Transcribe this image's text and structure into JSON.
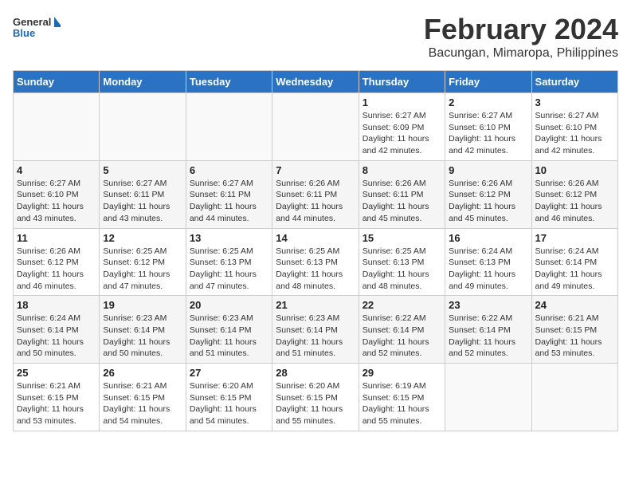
{
  "logo": {
    "general": "General",
    "blue": "Blue"
  },
  "title": "February 2024",
  "subtitle": "Bacungan, Mimaropa, Philippines",
  "days_of_week": [
    "Sunday",
    "Monday",
    "Tuesday",
    "Wednesday",
    "Thursday",
    "Friday",
    "Saturday"
  ],
  "weeks": [
    [
      {
        "day": "",
        "info": ""
      },
      {
        "day": "",
        "info": ""
      },
      {
        "day": "",
        "info": ""
      },
      {
        "day": "",
        "info": ""
      },
      {
        "day": "1",
        "info": "Sunrise: 6:27 AM\nSunset: 6:09 PM\nDaylight: 11 hours and 42 minutes."
      },
      {
        "day": "2",
        "info": "Sunrise: 6:27 AM\nSunset: 6:10 PM\nDaylight: 11 hours and 42 minutes."
      },
      {
        "day": "3",
        "info": "Sunrise: 6:27 AM\nSunset: 6:10 PM\nDaylight: 11 hours and 42 minutes."
      }
    ],
    [
      {
        "day": "4",
        "info": "Sunrise: 6:27 AM\nSunset: 6:10 PM\nDaylight: 11 hours and 43 minutes."
      },
      {
        "day": "5",
        "info": "Sunrise: 6:27 AM\nSunset: 6:11 PM\nDaylight: 11 hours and 43 minutes."
      },
      {
        "day": "6",
        "info": "Sunrise: 6:27 AM\nSunset: 6:11 PM\nDaylight: 11 hours and 44 minutes."
      },
      {
        "day": "7",
        "info": "Sunrise: 6:26 AM\nSunset: 6:11 PM\nDaylight: 11 hours and 44 minutes."
      },
      {
        "day": "8",
        "info": "Sunrise: 6:26 AM\nSunset: 6:11 PM\nDaylight: 11 hours and 45 minutes."
      },
      {
        "day": "9",
        "info": "Sunrise: 6:26 AM\nSunset: 6:12 PM\nDaylight: 11 hours and 45 minutes."
      },
      {
        "day": "10",
        "info": "Sunrise: 6:26 AM\nSunset: 6:12 PM\nDaylight: 11 hours and 46 minutes."
      }
    ],
    [
      {
        "day": "11",
        "info": "Sunrise: 6:26 AM\nSunset: 6:12 PM\nDaylight: 11 hours and 46 minutes."
      },
      {
        "day": "12",
        "info": "Sunrise: 6:25 AM\nSunset: 6:12 PM\nDaylight: 11 hours and 47 minutes."
      },
      {
        "day": "13",
        "info": "Sunrise: 6:25 AM\nSunset: 6:13 PM\nDaylight: 11 hours and 47 minutes."
      },
      {
        "day": "14",
        "info": "Sunrise: 6:25 AM\nSunset: 6:13 PM\nDaylight: 11 hours and 48 minutes."
      },
      {
        "day": "15",
        "info": "Sunrise: 6:25 AM\nSunset: 6:13 PM\nDaylight: 11 hours and 48 minutes."
      },
      {
        "day": "16",
        "info": "Sunrise: 6:24 AM\nSunset: 6:13 PM\nDaylight: 11 hours and 49 minutes."
      },
      {
        "day": "17",
        "info": "Sunrise: 6:24 AM\nSunset: 6:14 PM\nDaylight: 11 hours and 49 minutes."
      }
    ],
    [
      {
        "day": "18",
        "info": "Sunrise: 6:24 AM\nSunset: 6:14 PM\nDaylight: 11 hours and 50 minutes."
      },
      {
        "day": "19",
        "info": "Sunrise: 6:23 AM\nSunset: 6:14 PM\nDaylight: 11 hours and 50 minutes."
      },
      {
        "day": "20",
        "info": "Sunrise: 6:23 AM\nSunset: 6:14 PM\nDaylight: 11 hours and 51 minutes."
      },
      {
        "day": "21",
        "info": "Sunrise: 6:23 AM\nSunset: 6:14 PM\nDaylight: 11 hours and 51 minutes."
      },
      {
        "day": "22",
        "info": "Sunrise: 6:22 AM\nSunset: 6:14 PM\nDaylight: 11 hours and 52 minutes."
      },
      {
        "day": "23",
        "info": "Sunrise: 6:22 AM\nSunset: 6:14 PM\nDaylight: 11 hours and 52 minutes."
      },
      {
        "day": "24",
        "info": "Sunrise: 6:21 AM\nSunset: 6:15 PM\nDaylight: 11 hours and 53 minutes."
      }
    ],
    [
      {
        "day": "25",
        "info": "Sunrise: 6:21 AM\nSunset: 6:15 PM\nDaylight: 11 hours and 53 minutes."
      },
      {
        "day": "26",
        "info": "Sunrise: 6:21 AM\nSunset: 6:15 PM\nDaylight: 11 hours and 54 minutes."
      },
      {
        "day": "27",
        "info": "Sunrise: 6:20 AM\nSunset: 6:15 PM\nDaylight: 11 hours and 54 minutes."
      },
      {
        "day": "28",
        "info": "Sunrise: 6:20 AM\nSunset: 6:15 PM\nDaylight: 11 hours and 55 minutes."
      },
      {
        "day": "29",
        "info": "Sunrise: 6:19 AM\nSunset: 6:15 PM\nDaylight: 11 hours and 55 minutes."
      },
      {
        "day": "",
        "info": ""
      },
      {
        "day": "",
        "info": ""
      }
    ]
  ]
}
